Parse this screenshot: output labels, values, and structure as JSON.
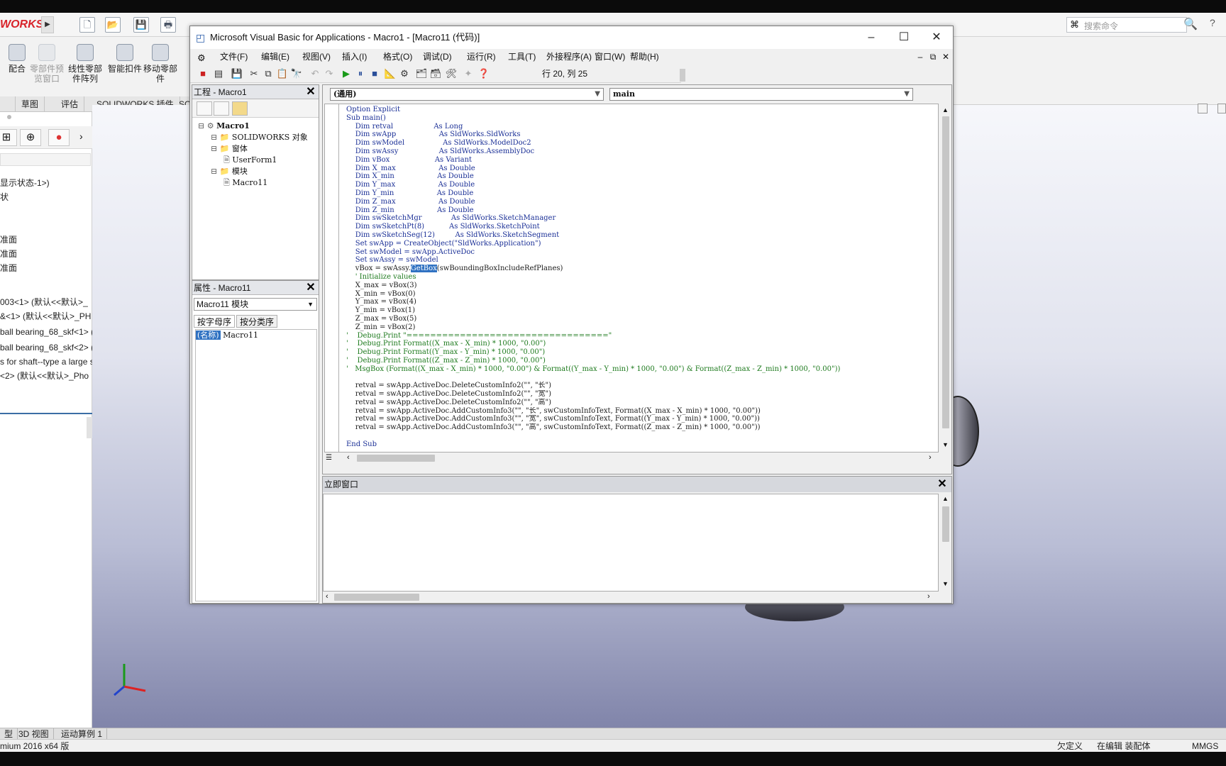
{
  "solidworks": {
    "logo": "WORKS",
    "search_placeholder": "搜索命令",
    "command_buttons": [
      {
        "label": "配合"
      },
      {
        "label": "零部件预览窗口"
      },
      {
        "label": "线性零部件阵列"
      },
      {
        "label": "智能扣件"
      },
      {
        "label": "移动零部件"
      }
    ],
    "tabs": [
      "草图",
      "评估",
      "SOLIDWORKS 插件",
      "SO"
    ],
    "tree_items": [
      "显示状态-1>)",
      "状",
      "",
      "",
      "准面",
      "准面",
      "准面",
      "",
      "003<1> (默认<<默认>_",
      "&<1> (默认<<默认>_PH",
      "ball bearing_68_skf<1> (",
      "ball bearing_68_skf<2> (",
      "s for shaft--type a large s",
      "<2> (默认<<默认>_Pho"
    ],
    "bottom_tabs": [
      "型",
      "3D 视图",
      "运动算例 1"
    ],
    "status_left": "mium 2016 x64 版",
    "status_items": [
      "欠定义",
      "在编辑 装配体",
      "MMGS"
    ]
  },
  "vba": {
    "title": "Microsoft Visual Basic for Applications - Macro1 - [Macro11 (代码)]",
    "menu": [
      "文件(F)",
      "编辑(E)",
      "视图(V)",
      "插入(I)",
      "格式(O)",
      "调试(D)",
      "运行(R)",
      "工具(T)",
      "外接程序(A)",
      "窗口(W)",
      "帮助(H)"
    ],
    "cursor_pos": "行 20, 列 25",
    "project": {
      "title": "工程 - Macro1",
      "tree": [
        {
          "label": "Macro1",
          "level": 0
        },
        {
          "label": "SOLIDWORKS 对象",
          "level": 1
        },
        {
          "label": "窗体",
          "level": 1
        },
        {
          "label": "UserForm1",
          "level": 2
        },
        {
          "label": "模块",
          "level": 1
        },
        {
          "label": "Macro11",
          "level": 2
        }
      ]
    },
    "properties": {
      "title": "属性 - Macro11",
      "object": "Macro11 模块",
      "tabs": [
        "按字母序",
        "按分类序"
      ],
      "name_key": "(名称)",
      "name_value": "Macro11"
    },
    "code": {
      "object_combo": "(通用)",
      "proc_combo": "main",
      "lines": [
        "Option Explicit",
        "Sub main()",
        "    Dim retval                  As Long",
        "    Dim swApp                   As SldWorks.SldWorks",
        "    Dim swModel                 As SldWorks.ModelDoc2",
        "    Dim swAssy                  As SldWorks.AssemblyDoc",
        "    Dim vBox                    As Variant",
        "    Dim X_max                   As Double",
        "    Dim X_min                   As Double",
        "    Dim Y_max                   As Double",
        "    Dim Y_min                   As Double",
        "    Dim Z_max                   As Double",
        "    Dim Z_min                   As Double",
        "    Dim swSketchMgr             As SldWorks.SketchManager",
        "    Dim swSketchPt(8)           As SldWorks.SketchPoint",
        "    Dim swSketchSeg(12)         As SldWorks.SketchSegment",
        "    Set swApp = CreateObject(\"SldWorks.Application\")",
        "    Set swModel = swApp.ActiveDoc",
        "    Set swAssy = swModel",
        "    vBox = swAssy.GetBox(swBoundingBoxIncludeRefPlanes)",
        "    ' Initialize values",
        "    X_max = vBox(3)",
        "    X_min = vBox(0)",
        "    Y_max = vBox(4)",
        "    Y_min = vBox(1)",
        "    Z_max = vBox(5)",
        "    Z_min = vBox(2)",
        "'    Debug.Print \"==================================\"",
        "'    Debug.Print Format((X_max - X_min) * 1000, \"0.00\")",
        "'    Debug.Print Format((Y_max - Y_min) * 1000, \"0.00\")",
        "'    Debug.Print Format((Z_max - Z_min) * 1000, \"0.00\")",
        "'   MsgBox (Format((X_max - X_min) * 1000, \"0.00\") & Format((Y_max - Y_min) * 1000, \"0.00\") & Format((Z_max - Z_min) * 1000, \"0.00\"))",
        "",
        "    retval = swApp.ActiveDoc.DeleteCustomInfo2(\"\", \"长\")",
        "    retval = swApp.ActiveDoc.DeleteCustomInfo2(\"\", \"宽\")",
        "    retval = swApp.ActiveDoc.DeleteCustomInfo2(\"\", \"高\")",
        "    retval = swApp.ActiveDoc.AddCustomInfo3(\"\", \"长\", swCustomInfoText, Format((X_max - X_min) * 1000, \"0.00\"))",
        "    retval = swApp.ActiveDoc.AddCustomInfo3(\"\", \"宽\", swCustomInfoText, Format((Y_max - Y_min) * 1000, \"0.00\"))",
        "    retval = swApp.ActiveDoc.AddCustomInfo3(\"\", \"高\", swCustomInfoText, Format((Z_max - Z_min) * 1000, \"0.00\"))",
        "",
        "End Sub"
      ],
      "selected_word": "GetBox"
    },
    "immediate_title": "立即窗口"
  },
  "colors": {
    "keyword": "#1a2f96",
    "comment": "#1d7a1d",
    "selection": "#3072c2",
    "brand": "#d8232a"
  }
}
